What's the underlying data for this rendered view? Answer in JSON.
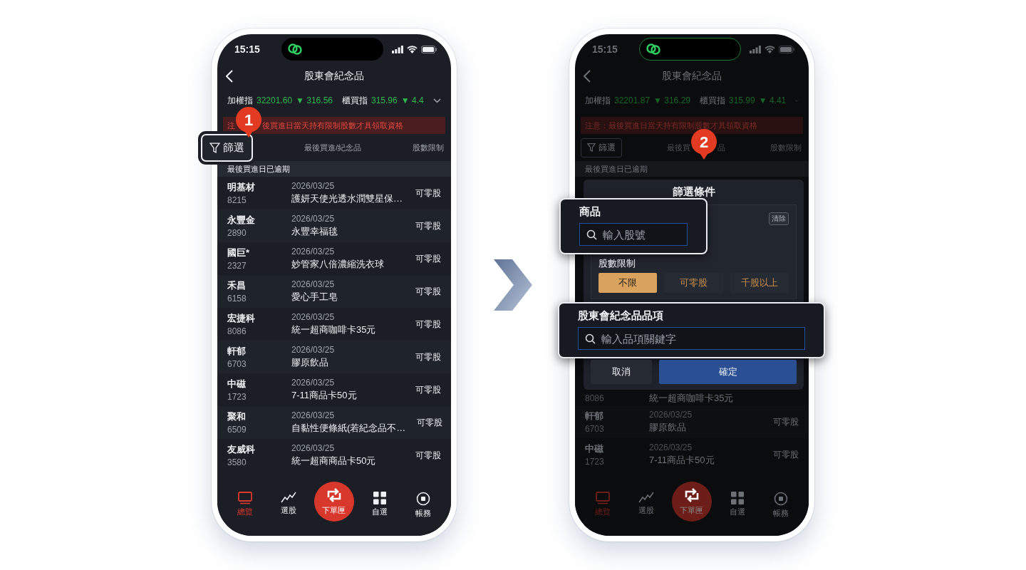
{
  "phones": [
    {
      "dimmed": false,
      "status_bar": {
        "time": "15:15"
      },
      "nav": {
        "title": "股東會紀念品"
      },
      "indices": [
        {
          "name": "加權指",
          "value": "32201.60",
          "change": "▼ 316.56"
        },
        {
          "name": "櫃買指",
          "value": "315.96",
          "change": "▼ 4.4"
        }
      ],
      "notice": {
        "parts": [
          "注",
          "後買進日當天持有限制股數才具領取資格"
        ],
        "step_badge": "1"
      },
      "filter_button": {
        "label": "篩選",
        "highlighted": true
      },
      "columns": [
        {
          "parts": [
            "最後買進/紀念品"
          ]
        },
        {
          "parts": [
            "股數限制"
          ]
        }
      ],
      "section": "最後買進日已逾期",
      "rows": [
        {
          "name": "明基材",
          "code": "8215",
          "date": "2026/03/25",
          "item": "護妍天使光透水潤雙星保…",
          "limit": "可零股"
        },
        {
          "name": "永豐金",
          "code": "2890",
          "date": "2026/03/25",
          "item": "永豐幸福毯",
          "limit": "可零股"
        },
        {
          "name": "國巨*",
          "code": "2327",
          "date": "2026/03/25",
          "item": "妙管家八倍濃縮洗衣球",
          "limit": "可零股"
        },
        {
          "name": "禾昌",
          "code": "6158",
          "date": "2026/03/25",
          "item": "愛心手工皂",
          "limit": "可零股"
        },
        {
          "name": "宏捷科",
          "code": "8086",
          "date": "2026/03/25",
          "item": "統一超商咖啡卡35元",
          "limit": "可零股"
        },
        {
          "name": "軒郁",
          "code": "6703",
          "date": "2026/03/25",
          "item": "膠原飲品",
          "limit": "可零股"
        },
        {
          "name": "中磁",
          "code": "1723",
          "date": "2026/03/25",
          "item": "7-11商品卡50元",
          "limit": "可零股"
        },
        {
          "name": "聚和",
          "code": "6509",
          "date": "2026/03/25",
          "item": "自黏性便條紙(若紀念品不…",
          "limit": "可零股"
        },
        {
          "name": "友威科",
          "code": "3580",
          "date": "2026/03/25",
          "item": "統一超商商品卡50元",
          "limit": "可零股"
        }
      ],
      "tabs": [
        {
          "label": "總覽",
          "kind": "monitor",
          "selected": true
        },
        {
          "label": "選股",
          "kind": "chart",
          "selected": false
        },
        {
          "label": "下單匣",
          "kind": "order",
          "selected": false
        },
        {
          "label": "自選",
          "kind": "grid",
          "selected": false
        },
        {
          "label": "帳務",
          "kind": "record",
          "selected": false
        }
      ]
    },
    {
      "dimmed": true,
      "status_bar": {
        "time": "15:15"
      },
      "nav": {
        "title": "股東會紀念品"
      },
      "indices": [
        {
          "name": "加權指",
          "value": "32201.87",
          "change": "▼ 316.29"
        },
        {
          "name": "櫃買指",
          "value": "315.99",
          "change": "▼ 4.41"
        }
      ],
      "notice": {
        "parts": [
          "注意：最後買進日當天持有限制股數才具領取資格"
        ]
      },
      "filter_button": {
        "label": "篩選",
        "highlighted": false
      },
      "columns": [
        {
          "parts": [
            "最後買",
            "品"
          ],
          "step_badge": "2"
        },
        {
          "parts": [
            "股數限制"
          ]
        }
      ],
      "section": "最後買進日已逾期",
      "filter_dialog": {
        "title": "篩選條件",
        "product_field": {
          "label": "商品",
          "placeholder": "輸入股號",
          "highlighted": true
        },
        "clear_button": "清除",
        "limit_label": "股數限制",
        "limit_options": [
          {
            "label": "不限",
            "selected": true
          },
          {
            "label": "可零股",
            "selected": false
          },
          {
            "label": "千股以上",
            "selected": false
          }
        ],
        "item_field": {
          "label": "股東會紀念品品項",
          "placeholder": "輸入品項關鍵字",
          "highlighted": true
        },
        "buttons": [
          {
            "label": "取消",
            "kind": "secondary"
          },
          {
            "label": "確定",
            "kind": "primary"
          }
        ]
      },
      "rows": [
        {
          "code": "8086",
          "item": "統一超商咖啡卡35元"
        },
        {
          "name": "軒郁",
          "code": "6703",
          "date": "2026/03/25",
          "item": "膠原飲品",
          "limit": "可零股"
        },
        {
          "name": "中磁",
          "code": "1723",
          "date": "2026/03/25",
          "item": "7-11商品卡50元",
          "limit": "可零股"
        }
      ],
      "tabs": [
        {
          "label": "總覽",
          "kind": "monitor",
          "selected": true
        },
        {
          "label": "選股",
          "kind": "chart",
          "selected": false
        },
        {
          "label": "下單匣",
          "kind": "order",
          "selected": false
        },
        {
          "label": "自選",
          "kind": "grid",
          "selected": false
        },
        {
          "label": "帳務",
          "kind": "record",
          "selected": false
        }
      ]
    }
  ]
}
